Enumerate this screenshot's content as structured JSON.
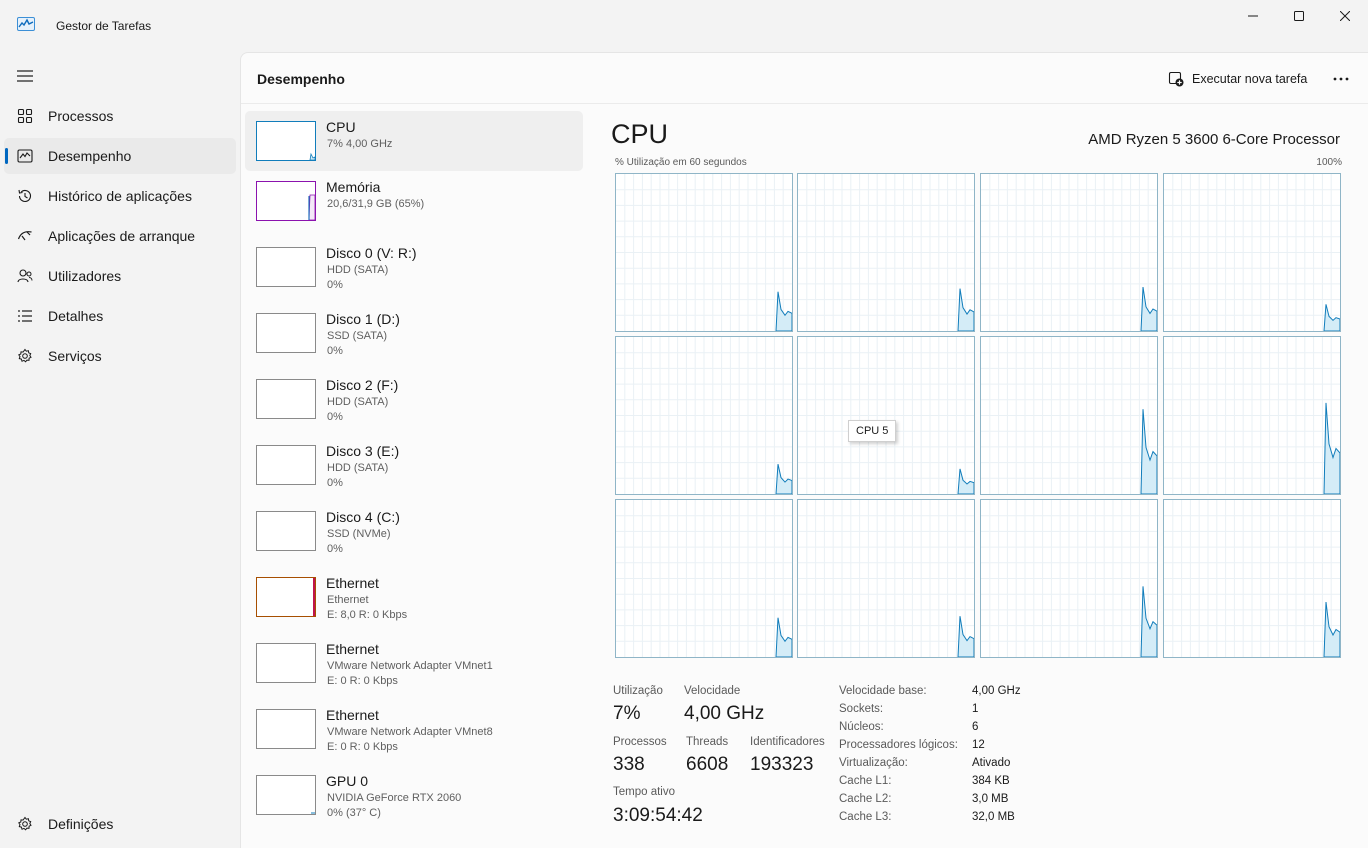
{
  "window": {
    "title": "Gestor de Tarefas"
  },
  "nav": {
    "items": [
      {
        "label": "Processos",
        "icon": "processes-icon"
      },
      {
        "label": "Desempenho",
        "icon": "performance-icon",
        "active": true
      },
      {
        "label": "Histórico de aplicações",
        "icon": "history-icon"
      },
      {
        "label": "Aplicações de arranque",
        "icon": "startup-icon"
      },
      {
        "label": "Utilizadores",
        "icon": "users-icon"
      },
      {
        "label": "Detalhes",
        "icon": "details-icon"
      },
      {
        "label": "Serviços",
        "icon": "services-icon"
      }
    ],
    "settings_label": "Definições"
  },
  "header": {
    "title": "Desempenho",
    "run_task_label": "Executar nova tarefa"
  },
  "devices": [
    {
      "name": "CPU",
      "sub1": "7%  4,00 GHz",
      "sub2": ""
    },
    {
      "name": "Memória",
      "sub1": "20,6/31,9 GB (65%)",
      "sub2": ""
    },
    {
      "name": "Disco 0 (V: R:)",
      "sub1": "HDD (SATA)",
      "sub2": "0%"
    },
    {
      "name": "Disco 1 (D:)",
      "sub1": "SSD (SATA)",
      "sub2": "0%"
    },
    {
      "name": "Disco 2 (F:)",
      "sub1": "HDD (SATA)",
      "sub2": "0%"
    },
    {
      "name": "Disco 3 (E:)",
      "sub1": "HDD (SATA)",
      "sub2": "0%"
    },
    {
      "name": "Disco 4 (C:)",
      "sub1": "SSD (NVMe)",
      "sub2": "0%"
    },
    {
      "name": "Ethernet",
      "sub1": "Ethernet",
      "sub2": "E: 8,0  R: 0 Kbps"
    },
    {
      "name": "Ethernet",
      "sub1": "VMware Network Adapter VMnet1",
      "sub2": "E: 0  R: 0 Kbps"
    },
    {
      "name": "Ethernet",
      "sub1": "VMware Network Adapter VMnet8",
      "sub2": "E: 0  R: 0 Kbps"
    },
    {
      "name": "GPU 0",
      "sub1": "NVIDIA GeForce RTX 2060",
      "sub2": "0%  (37° C)"
    }
  ],
  "cpu": {
    "title": "CPU",
    "model": "AMD Ryzen 5 3600 6-Core Processor",
    "graph_caption": "% Utilização em 60 segundos",
    "graph_max": "100%",
    "tooltip": "CPU 5",
    "accent_color": "#117dbb",
    "fill_color": "#d4ecf7"
  },
  "stats": {
    "utilization_label": "Utilização",
    "utilization_value": "7%",
    "speed_label": "Velocidade",
    "speed_value": "4,00 GHz",
    "processes_label": "Processos",
    "processes_value": "338",
    "threads_label": "Threads",
    "threads_value": "6608",
    "handles_label": "Identificadores",
    "handles_value": "193323",
    "uptime_label": "Tempo ativo",
    "uptime_value": "3:09:54:42"
  },
  "specs": [
    {
      "label": "Velocidade base:",
      "value": "4,00 GHz"
    },
    {
      "label": "Sockets:",
      "value": "1"
    },
    {
      "label": "Núcleos:",
      "value": "6"
    },
    {
      "label": "Processadores lógicos:",
      "value": "12"
    },
    {
      "label": "Virtualização:",
      "value": "Ativado"
    },
    {
      "label": "Cache L1:",
      "value": "384 KB"
    },
    {
      "label": "Cache L2:",
      "value": "3,0 MB"
    },
    {
      "label": "Cache L3:",
      "value": "32,0 MB"
    }
  ]
}
